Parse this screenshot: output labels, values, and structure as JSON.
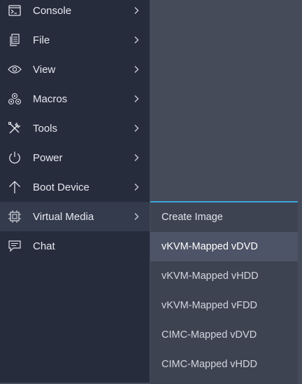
{
  "menu": {
    "items": [
      {
        "label": "Console",
        "icon": "console-icon"
      },
      {
        "label": "File",
        "icon": "file-icon"
      },
      {
        "label": "View",
        "icon": "eye-icon"
      },
      {
        "label": "Macros",
        "icon": "macros-icon"
      },
      {
        "label": "Tools",
        "icon": "tools-icon"
      },
      {
        "label": "Power",
        "icon": "power-icon"
      },
      {
        "label": "Boot Device",
        "icon": "arrow-up-icon"
      },
      {
        "label": "Virtual Media",
        "icon": "virtual-media-icon",
        "active": true
      },
      {
        "label": "Chat",
        "icon": "chat-icon"
      }
    ]
  },
  "submenu": {
    "items": [
      {
        "label": "Create Image"
      },
      {
        "label": "vKVM-Mapped vDVD",
        "highlighted": true
      },
      {
        "label": "vKVM-Mapped vHDD"
      },
      {
        "label": "vKVM-Mapped vFDD"
      },
      {
        "label": "CIMC-Mapped vDVD"
      },
      {
        "label": "CIMC-Mapped vHDD"
      }
    ]
  },
  "colors": {
    "menu_bg": "#272c3d",
    "active_item_bg": "#343b4d",
    "submenu_bg": "#3e4352",
    "submenu_highlight_bg": "#4e5467",
    "accent": "#3aa4e0",
    "text": "#e6e8ee"
  }
}
